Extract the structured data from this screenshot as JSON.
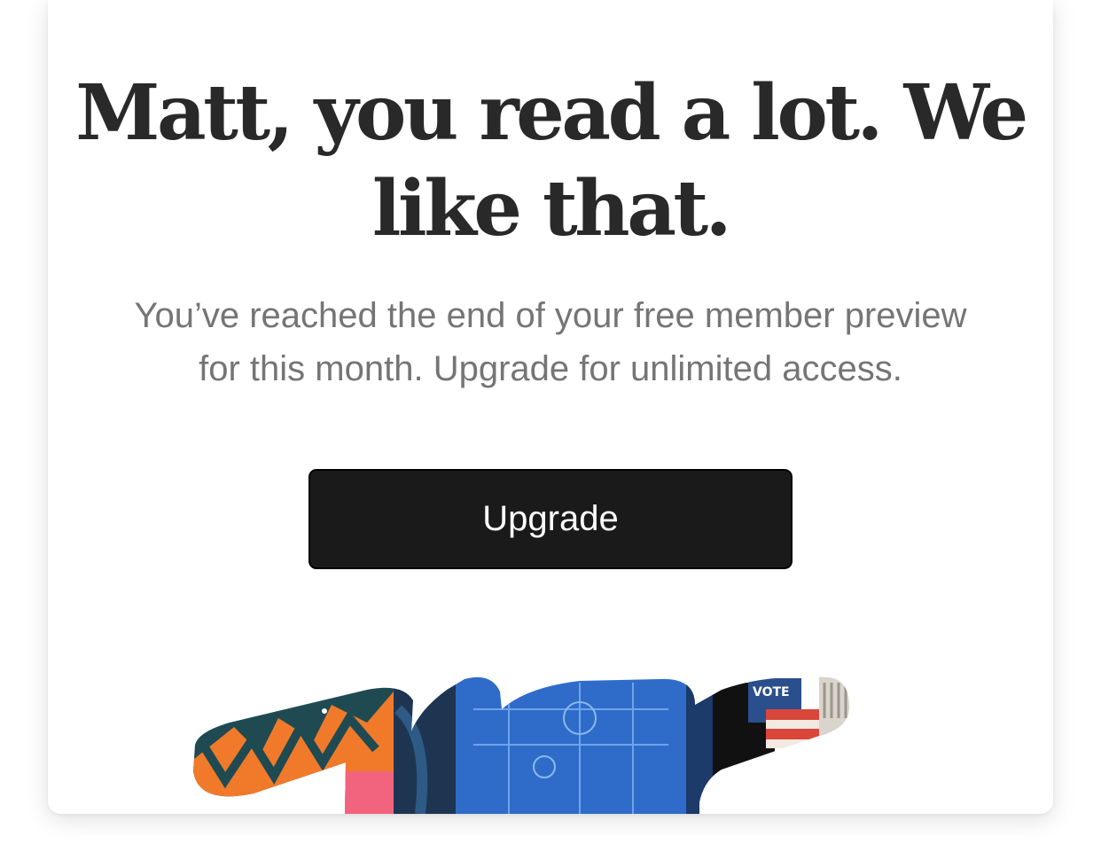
{
  "paywall": {
    "headline_line1": "Matt, you read a lot. We",
    "headline_line2": "like that.",
    "subtitle_line1": "You’ve reached the end of your free member preview",
    "subtitle_line2": "for this month. Upgrade for unlimited access.",
    "upgrade_label": "Upgrade"
  },
  "colors": {
    "card_background": "#ffffff",
    "headline": "#292929",
    "subtitle": "#757575",
    "button_background": "#1a1a1a",
    "button_text": "#ffffff"
  },
  "illustration": {
    "sign_text": "VOTE"
  }
}
